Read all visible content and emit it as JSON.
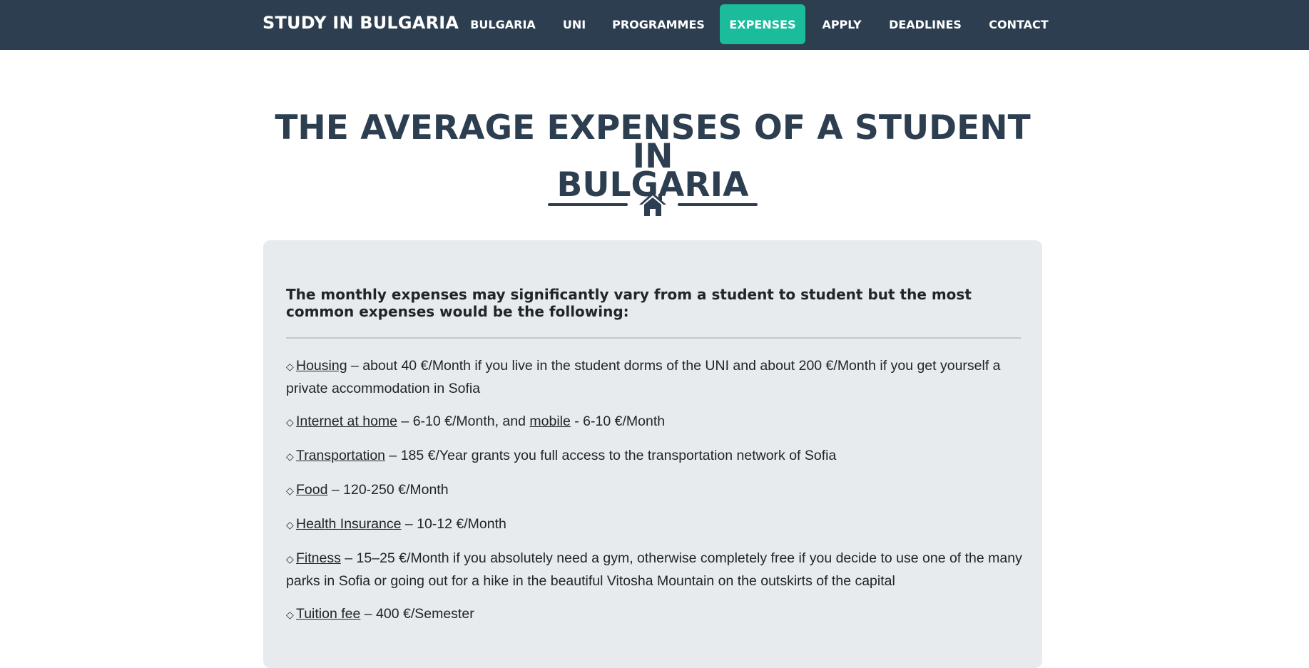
{
  "nav": {
    "brand": "STUDY IN BULGARIA",
    "items": [
      {
        "label": "BULGARIA",
        "active": false
      },
      {
        "label": "UNI",
        "active": false
      },
      {
        "label": "PROGRAMMES",
        "active": false
      },
      {
        "label": "EXPENSES",
        "active": true
      },
      {
        "label": "APPLY",
        "active": false
      },
      {
        "label": "DEADLINES",
        "active": false
      },
      {
        "label": "CONTACT",
        "active": false
      }
    ]
  },
  "page": {
    "title_line1": "THE AVERAGE EXPENSES OF A STUDENT IN",
    "title_line2": "BULGARIA",
    "divider_icon": "home-icon"
  },
  "content": {
    "lead": "The monthly expenses may significantly vary from a student to student but the most common expenses would be the following:",
    "bullet": "◇",
    "items": [
      {
        "link": "Housing",
        "text": " – about 40 €/Month if you live in the student dorms of the UNI and about 200 €/Month if you get yourself a private accommodation in Sofia"
      },
      {
        "link": "Internet at home",
        "text": " – 6-10 €/Month, and ",
        "link2": "mobile",
        "text2": " - 6-10 €/Month"
      },
      {
        "link": "Transportation",
        "text": " – 185 €/Year grants you full access to the transportation network of Sofia"
      },
      {
        "link": "Food",
        "text": " – 120-250 €/Month"
      },
      {
        "link": "Health Insurance",
        "text": " – 10-12 €/Month"
      },
      {
        "link": "Fitness",
        "text": " – 15–25 €/Month if you absolutely need a gym, otherwise completely free if you decide to use one of the many parks in Sofia or going out for a hike in the beautiful Vitosha Mountain on the outskirts of the capital"
      },
      {
        "link": "Tuition fee",
        "text": " – 400 €/Semester"
      }
    ]
  },
  "colors": {
    "navbar": "#2c3e50",
    "accent": "#1abc9c",
    "card": "#e7ebee",
    "heading": "#2c3e50"
  }
}
